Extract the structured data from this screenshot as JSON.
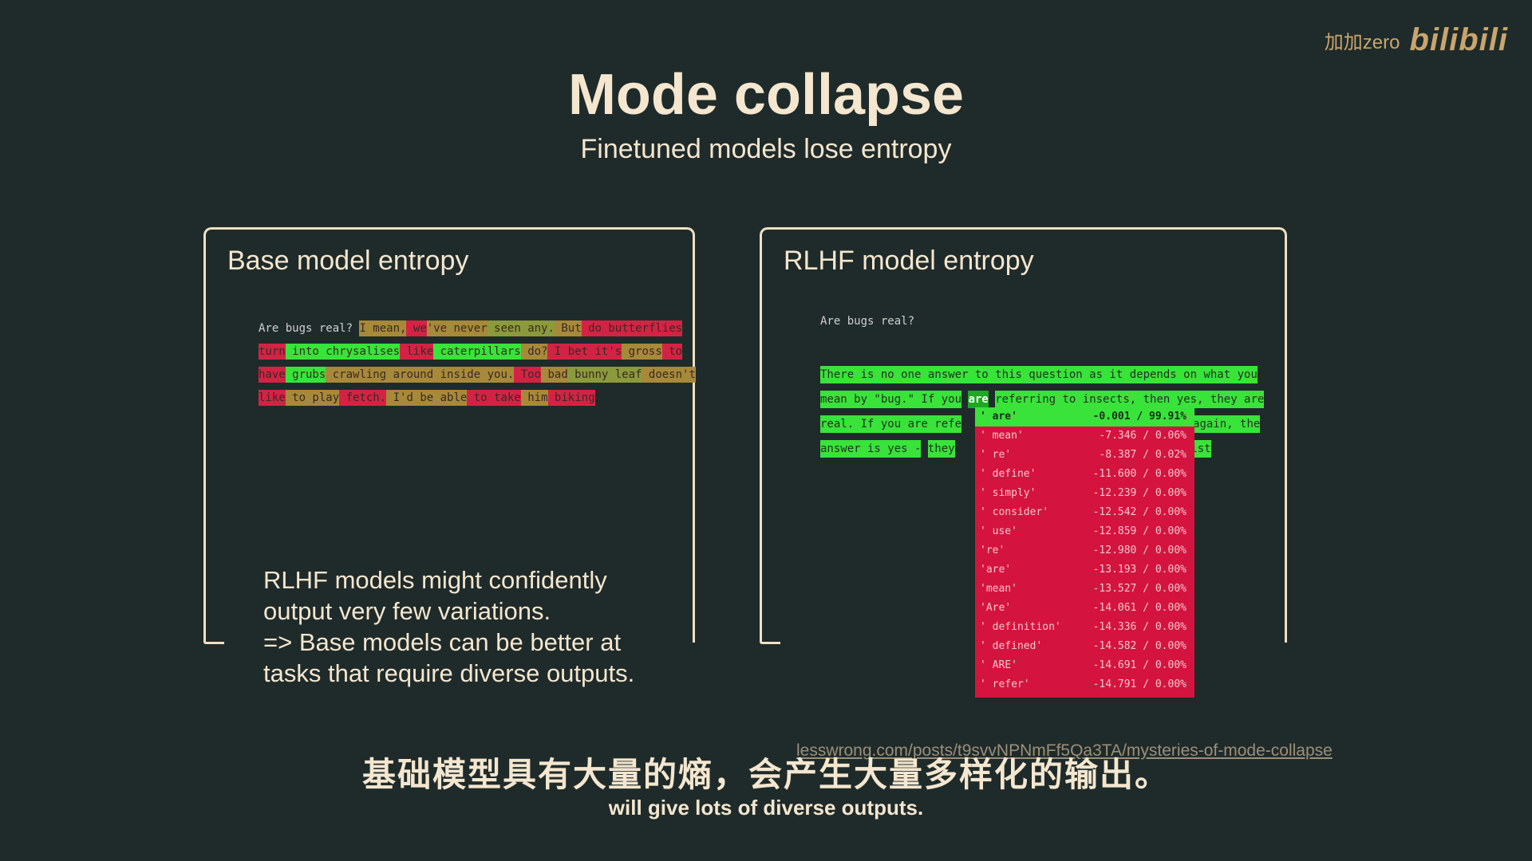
{
  "slide": {
    "title": "Mode collapse",
    "subtitle": "Finetuned models lose entropy",
    "watermark_user": "加加zero",
    "watermark_logo": "bilibili"
  },
  "left_panel": {
    "title": "Base model entropy",
    "prompt": "Are bugs real?",
    "tokens": [
      {
        "t": " I mean,",
        "c": "#a7893a"
      },
      {
        "t": " we",
        "c": "#d32345"
      },
      {
        "t": "'ve never",
        "c": "#a7893a"
      },
      {
        "t": " seen any.",
        "c": "#8b9a3b"
      },
      {
        "t": " But",
        "c": "#a7893a"
      },
      {
        "t": " do",
        "c": "#d32345"
      },
      {
        "t": " butterflies",
        "c": "#d32345"
      },
      {
        "t": " turn",
        "c": "#d32345"
      },
      {
        "t": " into",
        "c": "#39e33a"
      },
      {
        "t": " chrysalises",
        "c": "#39e33a"
      },
      {
        "t": " like",
        "c": "#d32345"
      },
      {
        "t": " caterpillars",
        "c": "#39e33a"
      },
      {
        "t": " do?",
        "c": "#a7893a"
      },
      {
        "t": " I bet it's",
        "c": "#d32345"
      },
      {
        "t": " gross",
        "c": "#a7893a"
      },
      {
        "t": " to",
        "c": "#d32345"
      },
      {
        "t": " have",
        "c": "#d32345"
      },
      {
        "t": " grubs",
        "c": "#39e33a"
      },
      {
        "t": " crawling around inside you.",
        "c": "#a7893a"
      },
      {
        "t": " Too",
        "c": "#d32345"
      },
      {
        "t": " bad",
        "c": "#a7893a"
      },
      {
        "t": " bunny leaf",
        "c": "#8b9a3b"
      },
      {
        "t": " doesn't",
        "c": "#a7893a"
      },
      {
        "t": " like",
        "c": "#d32345"
      },
      {
        "t": " to play",
        "c": "#a7893a"
      },
      {
        "t": " fetch.",
        "c": "#d32345"
      },
      {
        "t": " I'd be able",
        "c": "#a7893a"
      },
      {
        "t": " to",
        "c": "#d32345"
      },
      {
        "t": " take",
        "c": "#d32345"
      },
      {
        "t": " him",
        "c": "#a7893a"
      },
      {
        "t": " biking",
        "c": "#d32345"
      }
    ]
  },
  "right_panel": {
    "title": "RLHF model entropy",
    "prompt": "Are bugs real?",
    "line1": "There is no one answer to this question as it depends on what you",
    "line2a": "mean by \"bug.\" If you",
    "line2b": "are",
    "line2c": "referring to insects, then yes, they are",
    "line3a": "real. If you are refe",
    "line3b": "again, the",
    "line4a": "answer is yes -",
    "line4b": "they",
    "line4c": "y exist",
    "popup": [
      {
        "tok": "' are'",
        "val": "-0.001 / 99.91%"
      },
      {
        "tok": "' mean'",
        "val": "-7.346 / 0.06%"
      },
      {
        "tok": "' re'",
        "val": "-8.387 / 0.02%"
      },
      {
        "tok": "' define'",
        "val": "-11.600 / 0.00%"
      },
      {
        "tok": "' simply'",
        "val": "-12.239 / 0.00%"
      },
      {
        "tok": "' consider'",
        "val": "-12.542 / 0.00%"
      },
      {
        "tok": "' use'",
        "val": "-12.859 / 0.00%"
      },
      {
        "tok": "'re'",
        "val": "-12.980 / 0.00%"
      },
      {
        "tok": "'are'",
        "val": "-13.193 / 0.00%"
      },
      {
        "tok": "'mean'",
        "val": "-13.527 / 0.00%"
      },
      {
        "tok": "'Are'",
        "val": "-14.061 / 0.00%"
      },
      {
        "tok": "' definition'",
        "val": "-14.336 / 0.00%"
      },
      {
        "tok": "' defined'",
        "val": "-14.582 / 0.00%"
      },
      {
        "tok": "' ARE'",
        "val": "-14.691 / 0.00%"
      },
      {
        "tok": "' refer'",
        "val": "-14.791 / 0.00%"
      }
    ]
  },
  "note": {
    "line1": "RLHF models might confidently",
    "line2": "output very few variations.",
    "line3": "=> Base models can be better at",
    "line4": "tasks that require diverse outputs."
  },
  "link": "lesswrong.com/posts/t9svvNPNmFf5Qa3TA/mysteries-of-mode-collapse",
  "subtitle_cn": "基础模型具有大量的熵，会产生大量多样化的输出。",
  "subtitle_en": "will give lots of diverse outputs."
}
